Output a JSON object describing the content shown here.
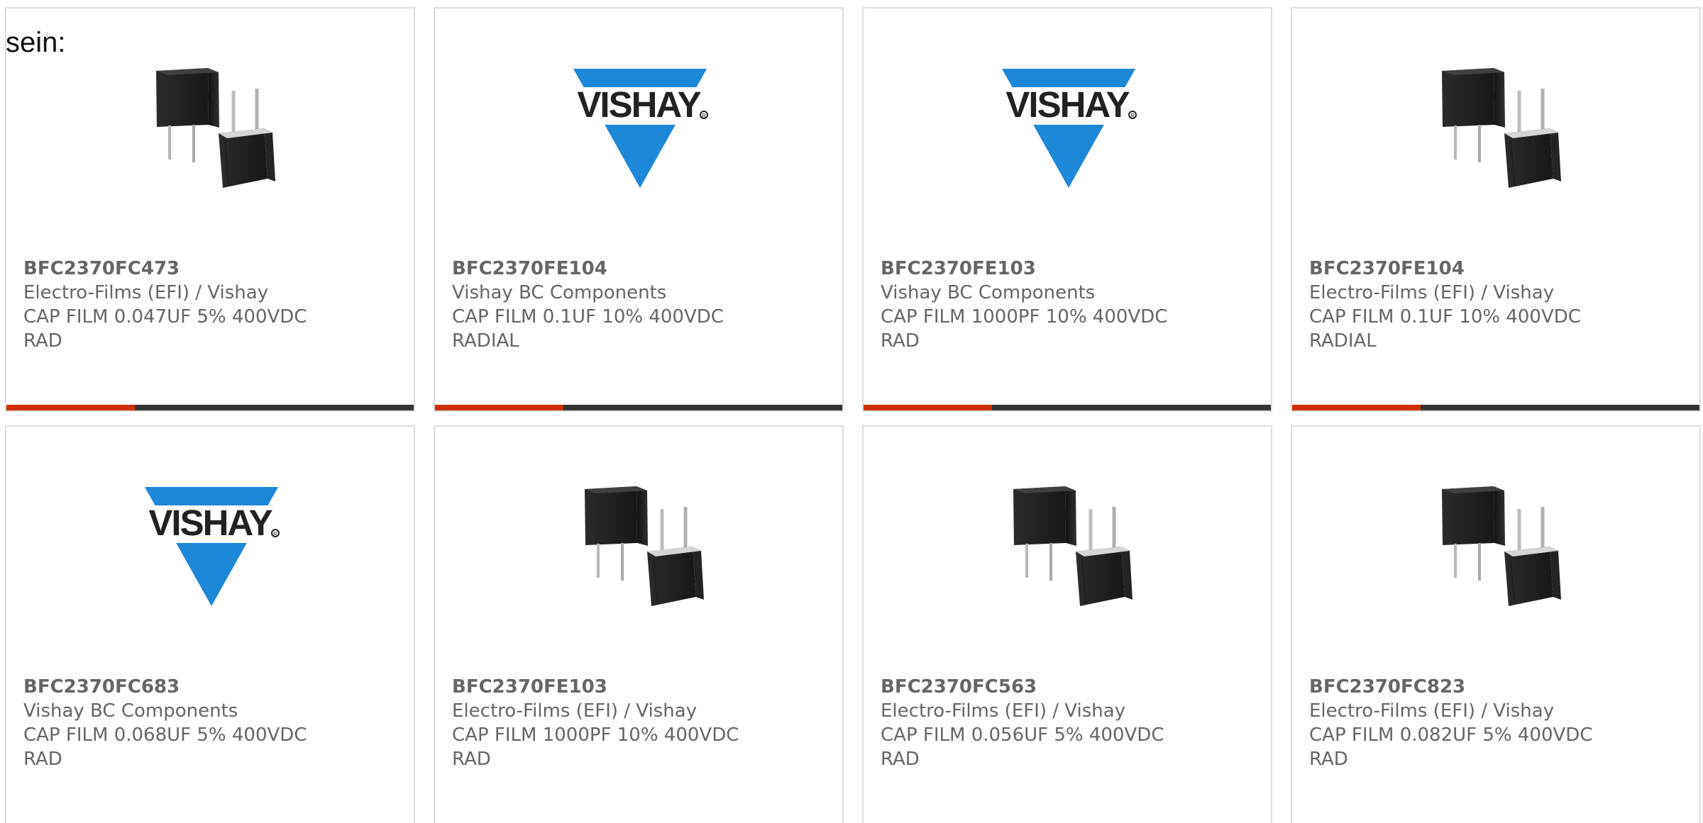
{
  "intro_text": "sein:",
  "colors": {
    "card_border": "#dddddd",
    "text": "#666666",
    "accent": "#cf3000",
    "track": "#333333",
    "vishay_blue": "#1e88d8"
  },
  "cards": [
    {
      "part_number": "BFC2370FC473",
      "manufacturer": "Electro-Films (EFI) / Vishay",
      "description": "CAP FILM 0.047UF 5% 400VDC",
      "package": "RAD",
      "image": "capacitor-product-image",
      "progress_fraction": 0.315
    },
    {
      "part_number": "BFC2370FE104",
      "manufacturer": "Vishay BC Components",
      "description": "CAP FILM 0.1UF 10% 400VDC",
      "package": "RADIAL",
      "image": "vishay-logo",
      "logo_text": "VISHAY",
      "progress_fraction": 0.315
    },
    {
      "part_number": "BFC2370FE103",
      "manufacturer": "Vishay BC Components",
      "description": "CAP FILM 1000PF 10% 400VDC",
      "package": "RAD",
      "image": "vishay-logo",
      "logo_text": "VISHAY",
      "progress_fraction": 0.315
    },
    {
      "part_number": "BFC2370FE104",
      "manufacturer": "Electro-Films (EFI) / Vishay",
      "description": "CAP FILM 0.1UF 10% 400VDC",
      "package": "RADIAL",
      "image": "capacitor-product-image",
      "progress_fraction": 0.315
    },
    {
      "part_number": "BFC2370FC683",
      "manufacturer": "Vishay BC Components",
      "description": "CAP FILM 0.068UF 5% 400VDC",
      "package": "RAD",
      "image": "vishay-logo",
      "logo_text": "VISHAY"
    },
    {
      "part_number": "BFC2370FE103",
      "manufacturer": "Electro-Films (EFI) / Vishay",
      "description": "CAP FILM 1000PF 10% 400VDC",
      "package": "RAD",
      "image": "capacitor-product-image"
    },
    {
      "part_number": "BFC2370FC563",
      "manufacturer": "Electro-Films (EFI) / Vishay",
      "description": "CAP FILM 0.056UF 5% 400VDC",
      "package": "RAD",
      "image": "capacitor-product-image"
    },
    {
      "part_number": "BFC2370FC823",
      "manufacturer": "Electro-Films (EFI) / Vishay",
      "description": "CAP FILM 0.082UF 5% 400VDC",
      "package": "RAD",
      "image": "capacitor-product-image"
    }
  ]
}
